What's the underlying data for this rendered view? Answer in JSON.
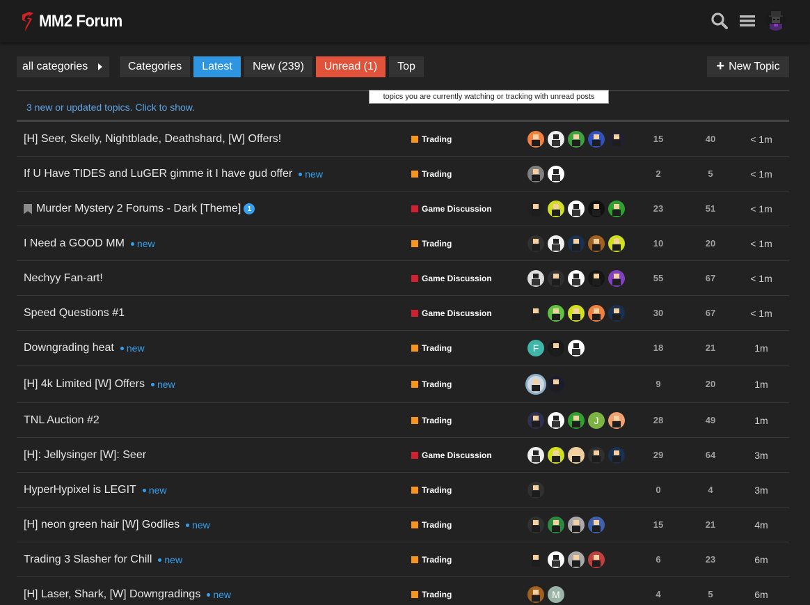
{
  "header": {
    "site_title": "MM2 Forum",
    "icons": [
      "search-icon",
      "hamburger-menu-icon",
      "user-avatar"
    ]
  },
  "nav": {
    "category_dropdown": "all categories",
    "pills": [
      "Categories",
      "Latest",
      "New (239)",
      "Unread (1)",
      "Top"
    ],
    "new_topic": "New Topic",
    "tooltip": "topics you are currently watching or tracking with unread posts"
  },
  "notice": "3 new or updated topics. Click to show.",
  "colors": {
    "accent_blue": "#2e95e0",
    "unread_red": "#e0533a",
    "trading": "#f7941d",
    "game_discussion": "#d1202f",
    "new_badge": "#36a0f0"
  },
  "new_label": "new",
  "topics": [
    {
      "title": "[H] Seer, Skelly, Nightblade, Deathshard, [W] Offers!",
      "new": false,
      "category": "Trading",
      "replies": "15",
      "views": "40",
      "activity": "< 1m"
    },
    {
      "title": "If U Have TIDES and LuGER gimme it I have gud offer",
      "new": true,
      "category": "Trading",
      "replies": "2",
      "views": "5",
      "activity": "< 1m"
    },
    {
      "title": "Murder Mystery 2 Forums - Dark [Theme]",
      "new": false,
      "bookmarked": true,
      "unread_count": "1",
      "category": "Game Discussion",
      "replies": "23",
      "views": "51",
      "activity": "< 1m"
    },
    {
      "title": "I Need a GOOD MM",
      "new": true,
      "category": "Trading",
      "replies": "10",
      "views": "20",
      "activity": "< 1m"
    },
    {
      "title": "Nechyy Fan-art!",
      "new": false,
      "category": "Game Discussion",
      "replies": "55",
      "views": "67",
      "activity": "< 1m"
    },
    {
      "title": "Speed Questions #1",
      "new": false,
      "category": "Game Discussion",
      "replies": "30",
      "views": "67",
      "activity": "< 1m"
    },
    {
      "title": "Downgrading heat",
      "new": true,
      "category": "Trading",
      "replies": "18",
      "views": "21",
      "activity": "1m"
    },
    {
      "title": "[H] 4k Limited [W] Offers",
      "new": true,
      "category": "Trading",
      "replies": "9",
      "views": "20",
      "activity": "1m"
    },
    {
      "title": "TNL Auction #2",
      "new": false,
      "category": "Trading",
      "replies": "28",
      "views": "49",
      "activity": "1m"
    },
    {
      "title": "[H]: Jellysinger [W]: Seer",
      "new": false,
      "category": "Game Discussion",
      "replies": "29",
      "views": "64",
      "activity": "3m"
    },
    {
      "title": "HyperHypixel is LEGIT",
      "new": true,
      "category": "Trading",
      "replies": "0",
      "views": "4",
      "activity": "3m"
    },
    {
      "title": "[H] neon green hair [W] Godlies",
      "new": true,
      "category": "Trading",
      "replies": "15",
      "views": "21",
      "activity": "4m"
    },
    {
      "title": "Trading 3 Slasher for Chill",
      "new": true,
      "category": "Trading",
      "replies": "6",
      "views": "23",
      "activity": "6m"
    },
    {
      "title": "[H] Laser, Shark, [W] Downgradings",
      "new": true,
      "category": "Trading",
      "replies": "4",
      "views": "5",
      "activity": "6m"
    }
  ],
  "avatar_letters": {
    "F": "F",
    "J": "J",
    "M": "M"
  }
}
